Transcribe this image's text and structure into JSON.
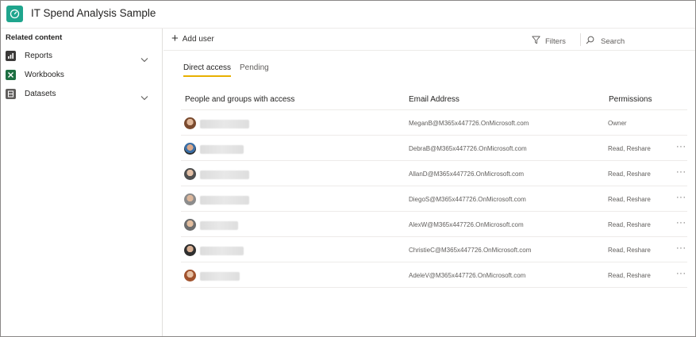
{
  "header": {
    "title": "IT Spend Analysis Sample",
    "app_icon": "gauge-icon",
    "accent": "#1fa58d"
  },
  "sidebar": {
    "heading": "Related content",
    "items": [
      {
        "label": "Reports",
        "icon": "report-icon",
        "expandable": true
      },
      {
        "label": "Workbooks",
        "icon": "excel-icon",
        "expandable": false
      },
      {
        "label": "Datasets",
        "icon": "dataset-icon",
        "expandable": true
      }
    ]
  },
  "toolbar": {
    "add_user_label": "Add user",
    "filters_label": "Filters",
    "search_placeholder": "Search"
  },
  "tabs": [
    {
      "label": "Direct access",
      "active": true
    },
    {
      "label": "Pending",
      "active": false
    }
  ],
  "table": {
    "columns": [
      "People and groups with access",
      "Email Address",
      "Permissions"
    ],
    "rows": [
      {
        "email": "MeganB@M365x447726.OnMicrosoft.com",
        "permission": "Owner",
        "more": ""
      },
      {
        "email": "DebraB@M365x447726.OnMicrosoft.com",
        "permission": "Read, Reshare",
        "more": "···"
      },
      {
        "email": "AllanD@M365x447726.OnMicrosoft.com",
        "permission": "Read, Reshare",
        "more": "···"
      },
      {
        "email": "DiegoS@M365x447726.OnMicrosoft.com",
        "permission": "Read, Reshare",
        "more": "···"
      },
      {
        "email": "AlexW@M365x447726.OnMicrosoft.com",
        "permission": "Read, Reshare",
        "more": "···"
      },
      {
        "email": "ChristieC@M365x447726.OnMicrosoft.com",
        "permission": "Read, Reshare",
        "more": "···"
      },
      {
        "email": "AdeleV@M365x447726.OnMicrosoft.com",
        "permission": "Read, Reshare",
        "more": "···"
      }
    ]
  }
}
